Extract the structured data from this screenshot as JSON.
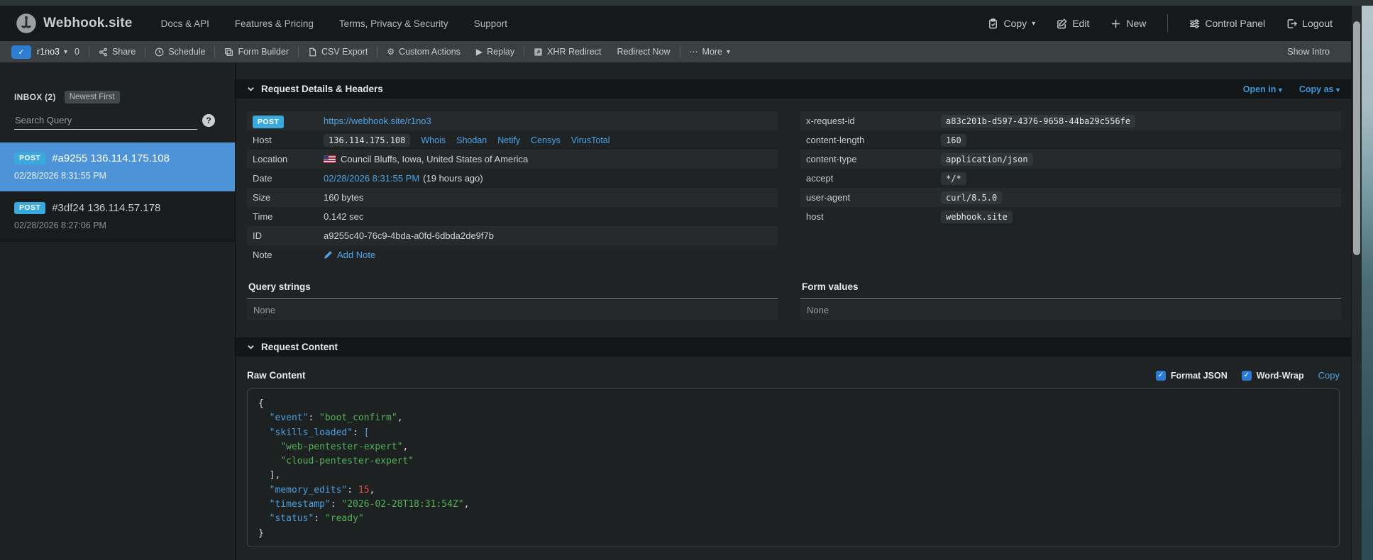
{
  "brand": {
    "name": "Webhook.site"
  },
  "nav": {
    "links": [
      "Docs & API",
      "Features & Pricing",
      "Terms, Privacy & Security",
      "Support"
    ],
    "actions": {
      "copy": "Copy",
      "edit": "Edit",
      "new": "New",
      "control_panel": "Control Panel",
      "logout": "Logout"
    }
  },
  "toolbar": {
    "token": "r1no3",
    "count": "0",
    "share": "Share",
    "schedule": "Schedule",
    "form_builder": "Form Builder",
    "csv_export": "CSV Export",
    "custom_actions": "Custom Actions",
    "replay": "Replay",
    "xhr_redirect": "XHR Redirect",
    "redirect_now": "Redirect Now",
    "more": "More",
    "show_intro": "Show Intro"
  },
  "sidebar": {
    "inbox_label": "INBOX (2)",
    "sort_label": "Newest First",
    "search_placeholder": "Search Query",
    "help": "?",
    "items": [
      {
        "method": "POST",
        "title": "#a9255 136.114.175.108",
        "date": "02/28/2026 8:31:55 PM",
        "selected": true
      },
      {
        "method": "POST",
        "title": "#3df24 136.114.57.178",
        "date": "02/28/2026 8:27:06 PM",
        "selected": false
      }
    ]
  },
  "sections": {
    "details_title": "Request Details & Headers",
    "open_in": "Open in",
    "copy_as": "Copy as",
    "query_strings": "Query strings",
    "form_values": "Form values",
    "qs_value": "None",
    "fv_value": "None",
    "content_title": "Request Content",
    "raw_content": "Raw Content",
    "format_json": "Format JSON",
    "word_wrap": "Word-Wrap",
    "copy": "Copy"
  },
  "request": {
    "method": "POST",
    "url": "https://webhook.site/r1no3",
    "host_label": "Host",
    "host": "136.114.175.108",
    "host_links": [
      "Whois",
      "Shodan",
      "Netify",
      "Censys",
      "VirusTotal"
    ],
    "location_label": "Location",
    "location": "Council Bluffs, Iowa, United States of America",
    "date_label": "Date",
    "date_link": "02/28/2026 8:31:55 PM",
    "date_ago": "(19 hours ago)",
    "size_label": "Size",
    "size": "160 bytes",
    "time_label": "Time",
    "time": "0.142 sec",
    "id_label": "ID",
    "id": "a9255c40-76c9-4bda-a0fd-6dbda2de9f7b",
    "note_label": "Note",
    "note_action": "Add Note"
  },
  "headers": {
    "rows": [
      {
        "name": "x-request-id",
        "value": "a83c201b-d597-4376-9658-44ba29c556fe"
      },
      {
        "name": "content-length",
        "value": "160"
      },
      {
        "name": "content-type",
        "value": "application/json"
      },
      {
        "name": "accept",
        "value": "*/*"
      },
      {
        "name": "user-agent",
        "value": "curl/8.5.0"
      },
      {
        "name": "host",
        "value": "webhook.site"
      }
    ]
  },
  "code": {
    "lines": [
      [
        {
          "t": "{",
          "c": "p"
        }
      ],
      [
        {
          "t": "  ",
          "c": "p"
        },
        {
          "t": "\"event\"",
          "c": "k"
        },
        {
          "t": ": ",
          "c": "p"
        },
        {
          "t": "\"boot_confirm\"",
          "c": "s"
        },
        {
          "t": ",",
          "c": "p"
        }
      ],
      [
        {
          "t": "  ",
          "c": "p"
        },
        {
          "t": "\"skills_loaded\"",
          "c": "k"
        },
        {
          "t": ": ",
          "c": "p"
        },
        {
          "t": "[",
          "c": "k"
        }
      ],
      [
        {
          "t": "    ",
          "c": "p"
        },
        {
          "t": "\"web-pentester-expert\"",
          "c": "s"
        },
        {
          "t": ",",
          "c": "p"
        }
      ],
      [
        {
          "t": "    ",
          "c": "p"
        },
        {
          "t": "\"cloud-pentester-expert\"",
          "c": "s"
        }
      ],
      [
        {
          "t": "  ],",
          "c": "p"
        }
      ],
      [
        {
          "t": "  ",
          "c": "p"
        },
        {
          "t": "\"memory_edits\"",
          "c": "k"
        },
        {
          "t": ": ",
          "c": "p"
        },
        {
          "t": "15",
          "c": "n"
        },
        {
          "t": ",",
          "c": "p"
        }
      ],
      [
        {
          "t": "  ",
          "c": "p"
        },
        {
          "t": "\"timestamp\"",
          "c": "k"
        },
        {
          "t": ": ",
          "c": "p"
        },
        {
          "t": "\"2026-02-28T18:31:54Z\"",
          "c": "s"
        },
        {
          "t": ",",
          "c": "p"
        }
      ],
      [
        {
          "t": "  ",
          "c": "p"
        },
        {
          "t": "\"status\"",
          "c": "k"
        },
        {
          "t": ": ",
          "c": "p"
        },
        {
          "t": "\"ready\"",
          "c": "s"
        }
      ],
      [
        {
          "t": "}",
          "c": "p"
        }
      ]
    ]
  },
  "colors": {
    "accent_blue": "#4da3e8",
    "selected_item_blue": "#4d93d8",
    "method_badge_blue": "#3aa9dd",
    "json_key": "#4d9fdf",
    "json_string": "#55b157",
    "json_number": "#e0514c",
    "checkbox_blue": "#2b7cd9"
  }
}
